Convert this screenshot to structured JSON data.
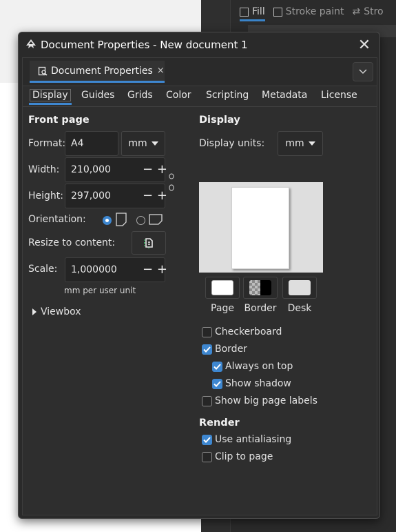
{
  "background": {
    "tabs": [
      {
        "label": "Fill",
        "active": true
      },
      {
        "label": "Stroke paint",
        "active": false
      },
      {
        "label": "Stro",
        "active": false
      }
    ]
  },
  "window": {
    "title": "Document Properties - New document 1",
    "close_icon": "close-icon",
    "dock_tab": {
      "label": "Document Properties",
      "close": "×"
    }
  },
  "tabs": [
    "Display",
    "Guides",
    "Grids",
    "Color",
    "Scripting",
    "Metadata",
    "License"
  ],
  "active_tab": "Display",
  "front_page": {
    "heading": "Front page",
    "format_label": "Format:",
    "format_value": "A4",
    "format_unit": "mm",
    "width_label": "Width:",
    "width_value": "210,000",
    "height_label": "Height:",
    "height_value": "297,000",
    "orientation_label": "Orientation:",
    "orientation_selected": "portrait",
    "resize_label": "Resize to content:",
    "scale_label": "Scale:",
    "scale_value": "1,000000",
    "scale_unit_note": "mm per user unit",
    "viewbox_label": "Viewbox"
  },
  "display": {
    "heading": "Display",
    "units_label": "Display units:",
    "units_value": "mm",
    "swatches": [
      {
        "label": "Page",
        "color": "#ffffff"
      },
      {
        "label": "Border",
        "color": "#000000"
      },
      {
        "label": "Desk",
        "color": "#dedede"
      }
    ],
    "checkboxes": [
      {
        "label": "Checkerboard",
        "checked": false,
        "indent": false
      },
      {
        "label": "Border",
        "checked": true,
        "indent": false
      },
      {
        "label": "Always on top",
        "checked": true,
        "indent": true
      },
      {
        "label": "Show shadow",
        "checked": true,
        "indent": true
      },
      {
        "label": "Show big page labels",
        "checked": false,
        "indent": false
      }
    ]
  },
  "render": {
    "heading": "Render",
    "checkboxes": [
      {
        "label": "Use antialiasing",
        "checked": true
      },
      {
        "label": "Clip to page",
        "checked": false
      }
    ]
  },
  "colors": {
    "accent": "#3e87d0",
    "panel_bg": "#2e2e2e"
  }
}
